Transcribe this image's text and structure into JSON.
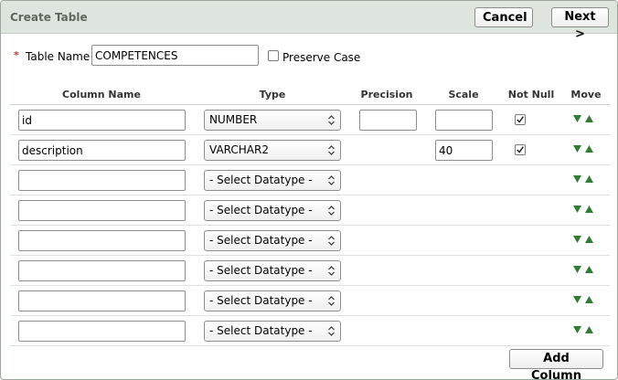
{
  "header": {
    "title": "Create Table",
    "cancel_label": "Cancel",
    "next_label": "Next >"
  },
  "table_name": {
    "required_marker": "*",
    "label": "Table Name",
    "value": "COMPETENCES",
    "preserve_case_label": "Preserve Case",
    "preserve_case_checked": false
  },
  "columns_headers": {
    "name": "Column Name",
    "type": "Type",
    "precision": "Precision",
    "scale": "Scale",
    "not_null": "Not Null",
    "move": "Move"
  },
  "rows": [
    {
      "name": "id",
      "type": "NUMBER",
      "precision_field": true,
      "precision": "",
      "scale_field": true,
      "scale": "",
      "not_null": true
    },
    {
      "name": "description",
      "type": "VARCHAR2",
      "precision_field": false,
      "precision": "",
      "scale_field": true,
      "scale": "40",
      "not_null": true
    },
    {
      "name": "",
      "type": "- Select Datatype -",
      "precision_field": false,
      "scale_field": false,
      "not_null": false
    },
    {
      "name": "",
      "type": "- Select Datatype -",
      "precision_field": false,
      "scale_field": false,
      "not_null": false
    },
    {
      "name": "",
      "type": "- Select Datatype -",
      "precision_field": false,
      "scale_field": false,
      "not_null": false
    },
    {
      "name": "",
      "type": "- Select Datatype -",
      "precision_field": false,
      "scale_field": false,
      "not_null": false
    },
    {
      "name": "",
      "type": "- Select Datatype -",
      "precision_field": false,
      "scale_field": false,
      "not_null": false
    },
    {
      "name": "",
      "type": "- Select Datatype -",
      "precision_field": false,
      "scale_field": false,
      "not_null": false
    }
  ],
  "footer": {
    "add_column_label": "Add Column"
  },
  "colors": {
    "titlebar_bg": "#dee5de",
    "move_arrow": "#2e7d32",
    "required_star": "#c0392b"
  },
  "icons": {
    "move_down": "triangle-down-icon",
    "move_up": "triangle-up-icon",
    "select_arrows": "updown-chevron-icon",
    "checkbox_checked": "checkmark-icon"
  }
}
